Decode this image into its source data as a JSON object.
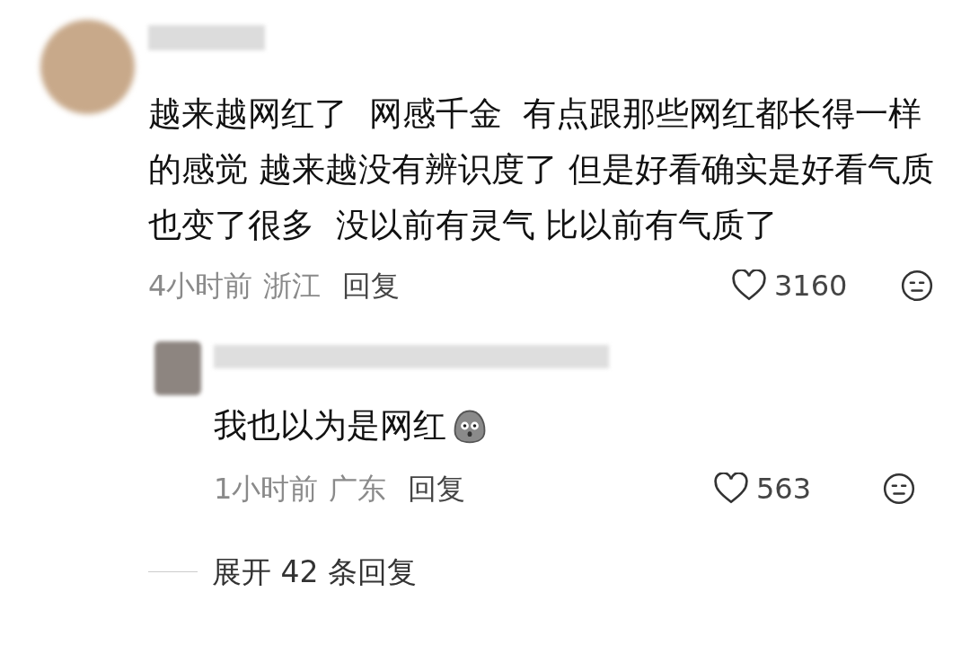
{
  "comment": {
    "text": "越来越网红了  网感千金  有点跟那些网红都长得一样的感觉 越来越没有辨识度了 但是好看确实是好看气质也变了很多  没以前有灵气 比以前有气质了",
    "time": "4小时前",
    "location": "浙江",
    "reply_label": "回复",
    "likes": "3160"
  },
  "reply": {
    "text": "我也以为是网红",
    "time": "1小时前",
    "location": "广东",
    "reply_label": "回复",
    "likes": "563"
  },
  "expand_label": "展开 42 条回复"
}
